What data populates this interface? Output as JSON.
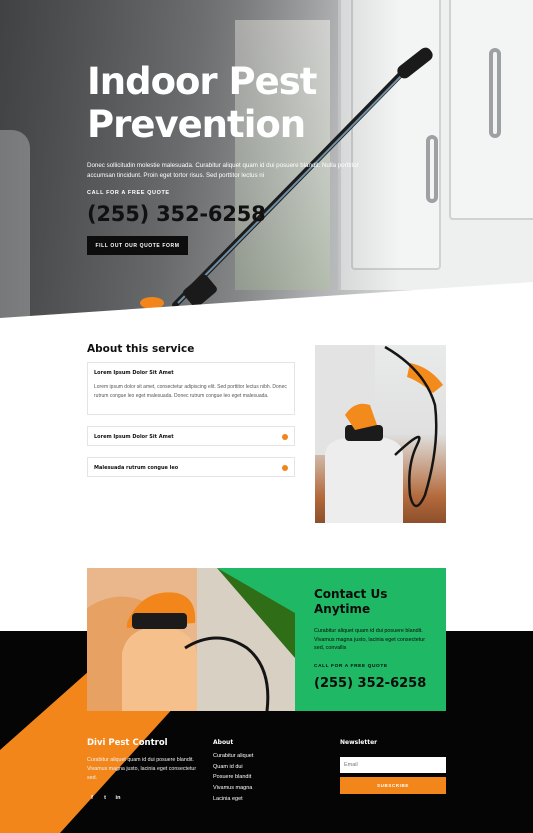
{
  "hero": {
    "title": "Indoor Pest Prevention",
    "text": "Donec sollicitudin molestie malesuada. Curabitur aliquet quam id dui posuere blandit. Nulla porttitor accumsan tincidunt. Proin eget tortor risus. Sed porttitor lectus ni",
    "quote_label": "CALL FOR A FREE QUOTE",
    "phone": "(255) 352-6258",
    "button_label": "FILL OUT OUR QUOTE FORM"
  },
  "about": {
    "title": "About this service",
    "accordion": [
      {
        "title": "Lorem Ipsum Dolor Sit Amet",
        "body": "Lorem ipsum dolor sit amet, consectetur adipiscing elit. Sed porttitor lectus nibh. Donec rutrum congue leo eget malesuada. Donec rutrum congue leo eget malesuada.",
        "open": true
      },
      {
        "title": "Lorem Ipsum Dolor Sit Amet",
        "open": false
      },
      {
        "title": "Malesuada rutrum congue leo",
        "open": false
      }
    ]
  },
  "contact": {
    "title": "Contact Us Anytime",
    "text": "Curabitur aliquet quam id dui posuere blandit. Vivamus magna justo, lacinia eget consectetur sed, convallis",
    "quote_label": "CALL FOR A FREE QUOTE",
    "phone": "(255) 352-6258"
  },
  "footer": {
    "brand": "Divi Pest Control",
    "text": "Curabitur aliquet quam id dui posuere blandit. Vivamus magna justo, lacinia eget consectetur sed.",
    "social": [
      {
        "icon": "facebook-icon",
        "glyph": "f"
      },
      {
        "icon": "twitter-icon",
        "glyph": "t"
      },
      {
        "icon": "linkedin-icon",
        "glyph": "in"
      }
    ],
    "about_title": "About",
    "about_links": [
      "Curabitur aliquet",
      "Quam id dui",
      "Posuere blandit",
      "Vivamus magna",
      "Lacinia eget"
    ],
    "newsletter_title": "Newsletter",
    "email_placeholder": "Email",
    "subscribe_label": "SUBSCRIBE"
  },
  "colors": {
    "accent_orange": "#f3861a",
    "accent_green": "#1fb865",
    "dark": "#050505"
  }
}
